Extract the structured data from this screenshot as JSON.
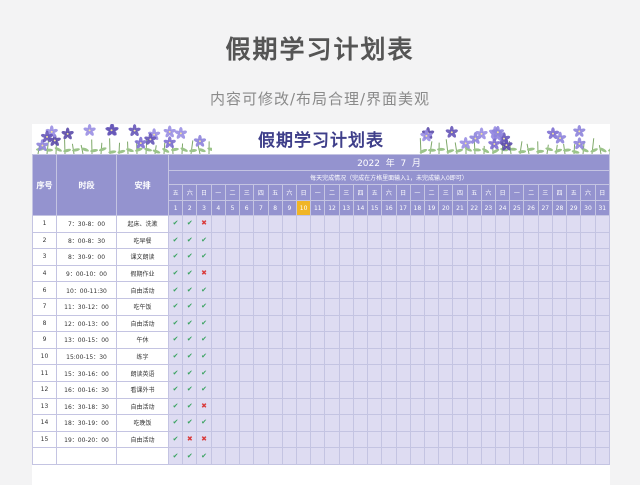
{
  "header": {
    "title": "假期学习计划表",
    "subtitle": "内容可修改/布局合理/界面美观"
  },
  "sheet": {
    "title": "假期学习计划表",
    "year": "2022",
    "year_unit": "年",
    "month": "7",
    "month_unit": "月",
    "note": "每天完成情况（完成在方格里面输入1，未完成输入0即可）",
    "columns": {
      "index": "序号",
      "time": "时段",
      "activity": "安排"
    },
    "weekdays": [
      "五",
      "六",
      "日",
      "一",
      "二",
      "三",
      "四",
      "五",
      "六",
      "日",
      "一",
      "二",
      "三",
      "四",
      "五",
      "六",
      "日",
      "一",
      "二",
      "三",
      "四",
      "五",
      "六",
      "日",
      "一",
      "二",
      "三",
      "四",
      "五",
      "六",
      "日"
    ],
    "days": [
      "1",
      "2",
      "3",
      "4",
      "5",
      "6",
      "7",
      "8",
      "9",
      "10",
      "11",
      "12",
      "13",
      "14",
      "15",
      "16",
      "17",
      "18",
      "19",
      "20",
      "21",
      "22",
      "23",
      "24",
      "25",
      "26",
      "27",
      "28",
      "29",
      "30",
      "31"
    ],
    "highlight_day": 10,
    "highlight_color": "#f0b526",
    "header_color": "#9493cf",
    "cell_color": "#dedcf2",
    "rows": [
      {
        "index": "1",
        "time": "7：30-8：00",
        "activity": "起床、洗漱",
        "marks": [
          "check",
          "check",
          "cross"
        ]
      },
      {
        "index": "2",
        "time": "8：00-8：30",
        "activity": "吃早餐",
        "marks": [
          "check",
          "check",
          "check"
        ]
      },
      {
        "index": "3",
        "time": "8：30-9：00",
        "activity": "课文朗读",
        "marks": [
          "check",
          "check",
          "check"
        ]
      },
      {
        "index": "4",
        "time": "9：00-10：00",
        "activity": "假期作业",
        "marks": [
          "check",
          "check",
          "cross"
        ]
      },
      {
        "index": "6",
        "time": "10：00-11:30",
        "activity": "自由活动",
        "marks": [
          "check",
          "check",
          "check"
        ]
      },
      {
        "index": "7",
        "time": "11：30-12：00",
        "activity": "吃午饭",
        "marks": [
          "check",
          "check",
          "check"
        ]
      },
      {
        "index": "8",
        "time": "12：00-13：00",
        "activity": "自由活动",
        "marks": [
          "check",
          "check",
          "check"
        ]
      },
      {
        "index": "9",
        "time": "13：00-15：00",
        "activity": "午休",
        "marks": [
          "check",
          "check",
          "check"
        ]
      },
      {
        "index": "10",
        "time": "15:00-15：30",
        "activity": "练字",
        "marks": [
          "check",
          "check",
          "check"
        ]
      },
      {
        "index": "11",
        "time": "15：30-16：00",
        "activity": "朗读英语",
        "marks": [
          "check",
          "check",
          "check"
        ]
      },
      {
        "index": "12",
        "time": "16：00-16：30",
        "activity": "看课外书",
        "marks": [
          "check",
          "check",
          "check"
        ]
      },
      {
        "index": "13",
        "time": "16：30-18：30",
        "activity": "自由活动",
        "marks": [
          "check",
          "check",
          "cross"
        ]
      },
      {
        "index": "14",
        "time": "18：30-19：00",
        "activity": "吃晚饭",
        "marks": [
          "check",
          "check",
          "check"
        ]
      },
      {
        "index": "15",
        "time": "19：00-20：00",
        "activity": "自由活动",
        "marks": [
          "check",
          "cross",
          "cross"
        ]
      },
      {
        "index": "",
        "time": "",
        "activity": "",
        "marks": [
          "check",
          "check",
          "check"
        ]
      }
    ],
    "mark_symbols": {
      "check": "✔",
      "cross": "✖"
    },
    "mark_colors": {
      "check": "#3aa361",
      "cross": "#d93a3a"
    },
    "decor_icon": "violet-flower-icon"
  }
}
